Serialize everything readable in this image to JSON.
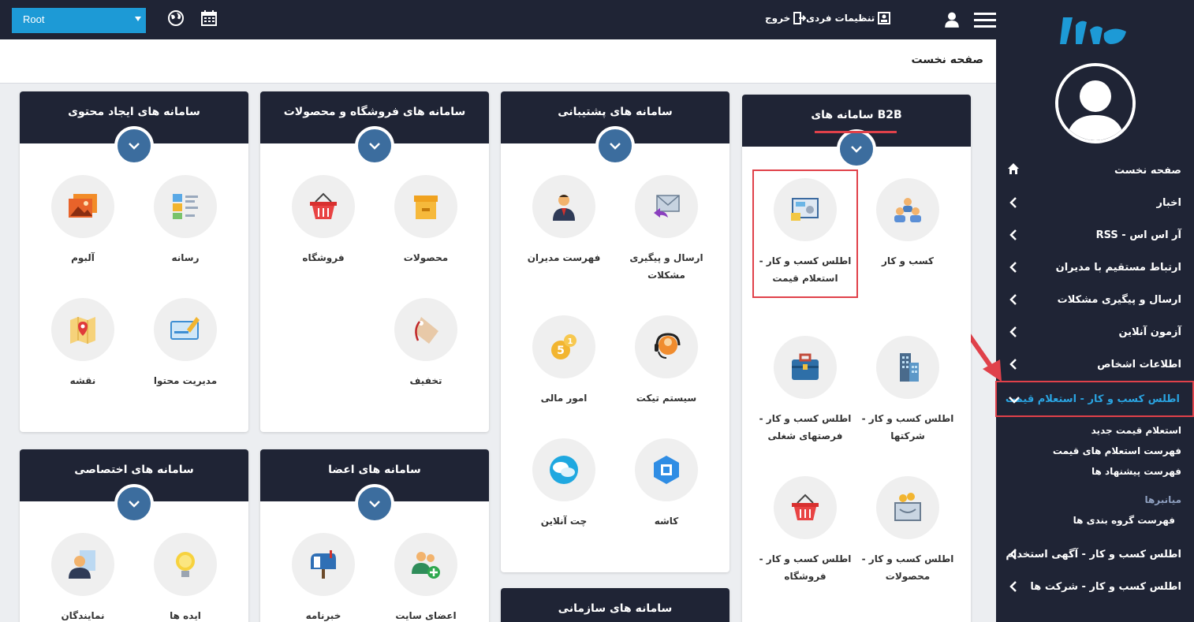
{
  "topbar": {
    "root_select": "Root",
    "settings_label": "تنظیمات فردی",
    "logout_label": "خروج"
  },
  "breadcrumb": {
    "title": "صفحه نخست"
  },
  "sidebar": {
    "items": [
      {
        "label": "صفحه نخست"
      },
      {
        "label": "اخبار"
      },
      {
        "label": "آر اس اس - RSS"
      },
      {
        "label": "ارتباط مستقیم با مدیران"
      },
      {
        "label": "ارسال و پیگیری مشکلات"
      },
      {
        "label": "آزمون آنلاین"
      },
      {
        "label": "اطلاعات اشخاص"
      },
      {
        "label": "اطلس کسب و کار - استعلام قیمت"
      }
    ],
    "submenu": [
      "استعلام قیمت جدید",
      "فهرست استعلام های قیمت",
      "فهرست پیشنهاد ها"
    ],
    "submenu_group": "میانبرها",
    "submenu_group_item": "فهرست گروه بندی ها",
    "items_after": [
      {
        "label": "اطلس کسب و کار - آگهی استخدام"
      },
      {
        "label": "اطلس کسب و کار - شرکت ها"
      }
    ]
  },
  "cards": {
    "b2b": {
      "title": "سامانه های B2B",
      "tiles": [
        "کسب و کار",
        "اطلس کسب و کار - استعلام قیمت",
        "اطلس کسب و کار - شرکتها",
        "اطلس کسب و کار - فرصتهای شغلی",
        "اطلس کسب و کار - محصولات",
        "اطلس کسب و کار - فروشگاه"
      ]
    },
    "support": {
      "title": "سامانه های پشتیبانی",
      "tiles": [
        "ارسال و پیگیری مشکلات",
        "فهرست مدیران",
        "سیستم تیکت",
        "امور مالی",
        "کاشه",
        "چت آنلاین"
      ]
    },
    "shop": {
      "title": "سامانه های فروشگاه و محصولات",
      "tiles": [
        "محصولات",
        "فروشگاه",
        "تخفیف"
      ]
    },
    "content": {
      "title": "سامانه های ایجاد محتوی",
      "tiles": [
        "رسانه",
        "آلبوم",
        "مدیریت محتوا",
        "نقشه"
      ]
    },
    "members": {
      "title": "سامانه های اعضا",
      "tiles": [
        "اعضای سایت",
        "خبرنامه"
      ]
    },
    "private": {
      "title": "سامانه های اختصاصی",
      "tiles": [
        "ایده ها",
        "نمایندگان"
      ]
    },
    "org": {
      "title": "سامانه های سازمانی"
    }
  },
  "colors": {
    "accent": "#1d9ad6",
    "dark": "#1f2435",
    "highlight": "#e0414a",
    "toggle": "#3c6d9e"
  }
}
